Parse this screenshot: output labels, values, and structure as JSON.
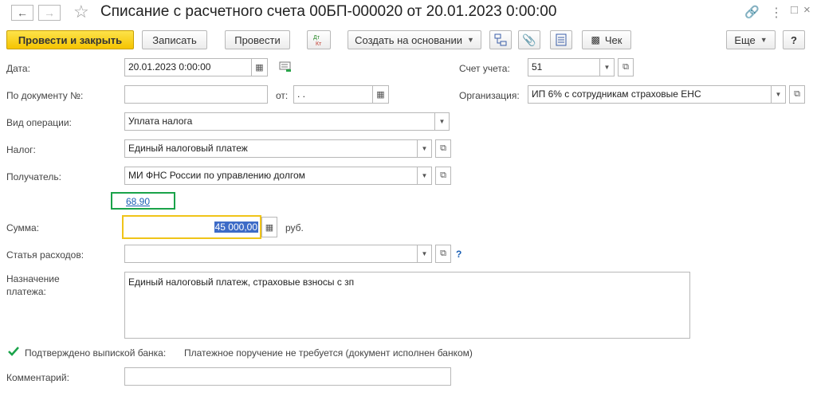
{
  "header": {
    "title": "Списание с расчетного счета 00БП-000020 от 20.01.2023 0:00:00"
  },
  "toolbar": {
    "post_close": "Провести и закрыть",
    "save": "Записать",
    "post": "Провести",
    "dt_kt": "Дт Кт",
    "create_based": "Создать на основании",
    "check": "Чек",
    "more": "Еще",
    "help": "?"
  },
  "form": {
    "date_label": "Дата:",
    "date_value": "20.01.2023  0:00:00",
    "doc_no_label": "По документу №:",
    "doc_no_value": "",
    "from_label": "от:",
    "from_value": " .  .",
    "account_label": "Счет учета:",
    "account_value": "51",
    "org_label": "Организация:",
    "org_value": "ИП 6% с сотрудникам страховые ЕНС",
    "operation_label": "Вид операции:",
    "operation_value": "Уплата налога",
    "tax_label": "Налог:",
    "tax_value": "Единый налоговый платеж",
    "recipient_label": "Получатель:",
    "recipient_value": "МИ ФНС России по управлению долгом",
    "link_value": "68.90",
    "sum_label": "Сумма:",
    "sum_value": "45 000,00",
    "currency": "руб.",
    "expense_label": "Статья расходов:",
    "expense_value": "",
    "expense_help": "?",
    "purpose_label": "Назначение платежа:",
    "purpose_value": "Единый налоговый платеж, страховые  взносы с зп",
    "confirmed_label": "Подтверждено выпиской банка:",
    "confirmed_checked": true,
    "confirmed_note": "Платежное поручение не требуется (документ исполнен банком)",
    "comment_label": "Комментарий:",
    "comment_value": ""
  },
  "colors": {
    "primary_button": "#f5c400",
    "link": "#1a5fb4",
    "link_highlight_border": "#1aa34a",
    "sum_focus_border": "#f0c419",
    "selection": "#3d6bc7",
    "checkbox": "#1aa34a"
  }
}
